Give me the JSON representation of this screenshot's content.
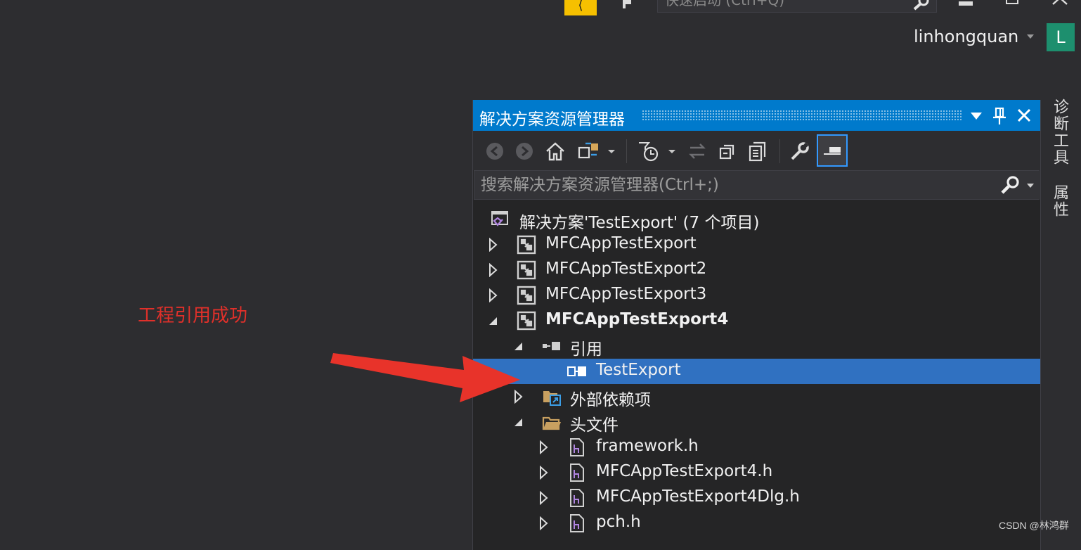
{
  "window": {
    "quick_launch_placeholder": "快速启动 (Ctrl+Q)",
    "user_name": "linhongquan",
    "avatar_letter": "L"
  },
  "side_tabs": [
    "诊断工具",
    "属性"
  ],
  "panel": {
    "title": "解决方案资源管理器",
    "search_placeholder": "搜索解决方案资源管理器(Ctrl+;)",
    "toolbar_icons": [
      "back-icon",
      "forward-icon",
      "home-icon",
      "switch-views-icon",
      "pending-changes-filter-icon",
      "sync-icon",
      "collapse-all-icon",
      "show-all-files-icon",
      "properties-icon",
      "preview-icon"
    ]
  },
  "tree": {
    "solution": "解决方案'TestExport' (7 个项目)",
    "projects": [
      "MFCAppTestExport",
      "MFCAppTestExport2",
      "MFCAppTestExport3",
      "MFCAppTestExport4"
    ],
    "references_folder": "引用",
    "reference_item": "TestExport",
    "external_deps": "外部依赖项",
    "header_files": "头文件",
    "header_items": [
      "framework.h",
      "MFCAppTestExport4.h",
      "MFCAppTestExport4Dlg.h",
      "pch.h"
    ]
  },
  "annotation": "工程引用成功",
  "watermark": "CSDN @林鸿群",
  "colors": {
    "accent": "#007acc",
    "selection": "#3071c1",
    "annotation": "#e0302a",
    "avatar": "#1d8f6e",
    "badge": "#f6c000"
  }
}
